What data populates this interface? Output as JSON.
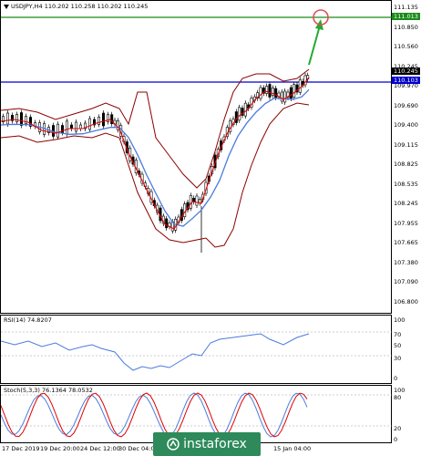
{
  "main": {
    "header": "USDJPY,H4  110.202 110.258 110.202 110.245",
    "price_ticks": [
      "111.135",
      "110.850",
      "110.560",
      "110.245",
      "109.970",
      "109.690",
      "109.400",
      "109.115",
      "108.825",
      "108.535",
      "108.245",
      "107.955",
      "107.665",
      "107.380",
      "107.090",
      "106.800"
    ],
    "tag_green": "111.013",
    "tag_current": "110.245",
    "tag_blue": "110.103",
    "colors": {
      "green_line": "#1a8a1a",
      "blue_line": "#0000cc",
      "bands": "#8b0000",
      "ma_fast": "#e00000",
      "ma_slow": "#4b7bdc",
      "candle": "#000000",
      "arrow": "#22aa33",
      "circle": "#e05050"
    }
  },
  "rsi": {
    "header": "RSI(14) 74.8207",
    "ticks": [
      "100",
      "70",
      "50",
      "30",
      "0"
    ]
  },
  "stoch": {
    "header": "Stoch(5,3,3) 76.1364 78.0532",
    "ticks": [
      "100",
      "80",
      "20",
      "0"
    ]
  },
  "xaxis": {
    "labels": [
      "17 Dec 2019",
      "19 Dec 20:00",
      "24 Dec 12:00",
      "30 Dec 04:00",
      "15 Jan 04:00"
    ]
  },
  "watermark": {
    "text": "instaforex"
  }
}
